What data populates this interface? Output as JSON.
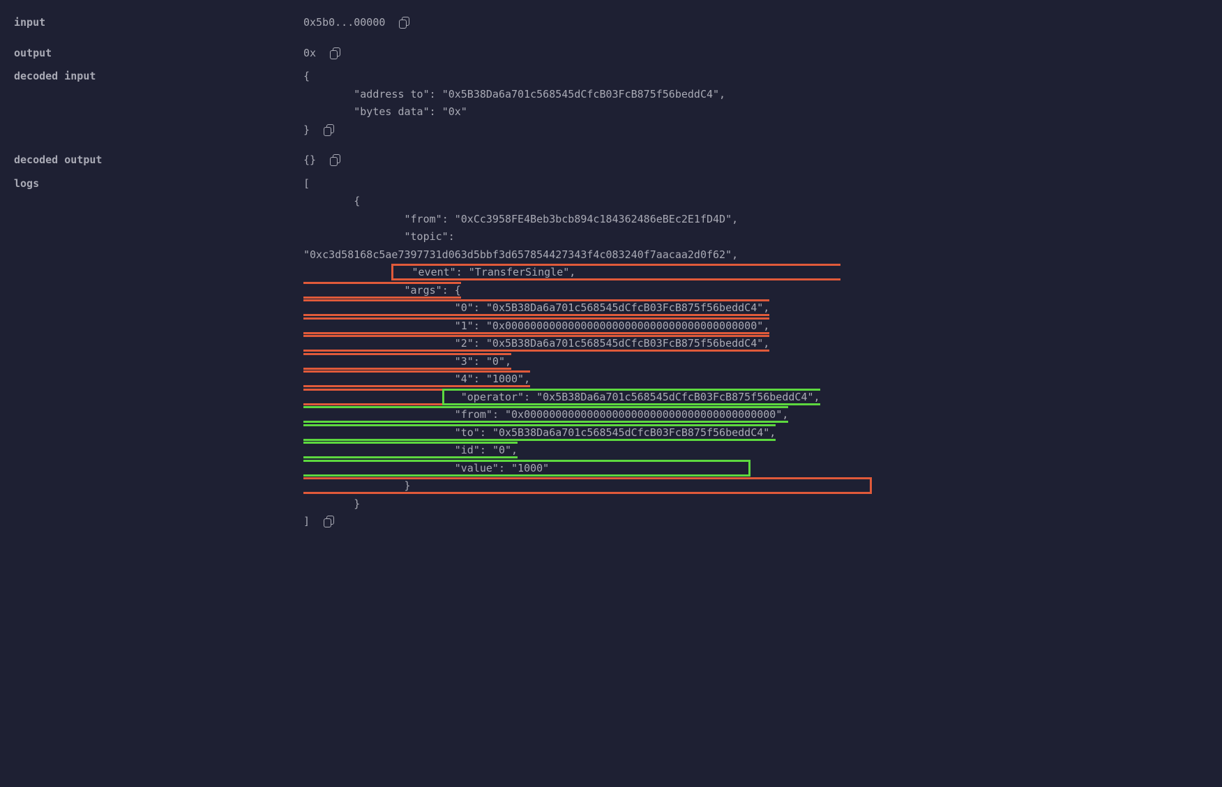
{
  "rows": {
    "input": {
      "label": "input",
      "value": "0x5b0...00000"
    },
    "output": {
      "label": "output",
      "value": "0x"
    },
    "decoded_input": {
      "label": "decoded input",
      "open": "{",
      "field1_key": "\"address to\"",
      "field1_sep": ": ",
      "field1_val": "\"0x5B38Da6a701c568545dCfcB03FcB875f56beddC4\"",
      "field1_comma": ",",
      "field2_key": "\"bytes data\"",
      "field2_sep": ": ",
      "field2_val": "\"0x\"",
      "close": "}"
    },
    "decoded_output": {
      "label": "decoded output",
      "value": "{}"
    },
    "logs": {
      "label": "logs",
      "arr_open": "[",
      "obj_open": "{",
      "from_key": "\"from\"",
      "from_val": "\"0xCc3958FE4Beb3bcb894c184362486eBEc2E1fD4D\"",
      "topic_key": "\"topic\"",
      "topic_val": "\"0xc3d58168c5ae7397731d063d5bbf3d657854427343f4c083240f7aacaa2d0f62\"",
      "event_key": "\"event\"",
      "event_val": "\"TransferSingle\"",
      "args_key": "\"args\"",
      "args_open": "{",
      "a0k": "\"0\"",
      "a0v": "\"0x5B38Da6a701c568545dCfcB03FcB875f56beddC4\"",
      "a1k": "\"1\"",
      "a1v": "\"0x0000000000000000000000000000000000000000\"",
      "a2k": "\"2\"",
      "a2v": "\"0x5B38Da6a701c568545dCfcB03FcB875f56beddC4\"",
      "a3k": "\"3\"",
      "a3v": "\"0\"",
      "a4k": "\"4\"",
      "a4v": "\"1000\"",
      "opk": "\"operator\"",
      "opv": "\"0x5B38Da6a701c568545dCfcB03FcB875f56beddC4\"",
      "frk": "\"from\"",
      "frv": "\"0x0000000000000000000000000000000000000000\"",
      "tok": "\"to\"",
      "tov": "\"0x5B38Da6a701c568545dCfcB03FcB875f56beddC4\"",
      "idk": "\"id\"",
      "idv": "\"0\"",
      "vak": "\"value\"",
      "vav": "\"1000\"",
      "args_close": "}",
      "obj_close": "}",
      "arr_close": "]",
      "sep": ": ",
      "comma": ","
    }
  }
}
